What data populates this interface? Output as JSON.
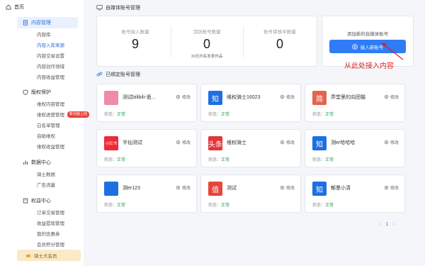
{
  "sidebar": {
    "home": "首页",
    "content_section": "内容管理",
    "content_items": [
      "内容库",
      "内容入库来源",
      "内容交易设置",
      "内容创作领域",
      "内容收益管理"
    ],
    "rights_section": "版权保护",
    "rights_items": [
      "维权内容管理",
      "维权进度管理",
      "白名单管理",
      "自助维权",
      "维权收益管理"
    ],
    "hot_badge": "新功能上线",
    "data_section": "数据中心",
    "data_items": [
      "骑士数据",
      "广告流量"
    ],
    "rights_center_section": "权益中心",
    "rights_center_items": [
      "订单交易管理",
      "收益提现管理",
      "我的优惠券",
      "会员积分管理"
    ],
    "vip_label": "骑士大会员"
  },
  "page": {
    "title": "自媒体账号管理",
    "stats": [
      {
        "label": "账号接入数量",
        "value": "9",
        "note": ""
      },
      {
        "label": "活跃账号数量",
        "value": "0",
        "note": "30天内有发表作品"
      },
      {
        "label": "账号审核中数量",
        "value": "0",
        "note": ""
      }
    ],
    "add_card_label": "添加新的自媒体账号",
    "add_button_label": "接入新账号",
    "annotation": "从此处接入内容",
    "bound_title": "已绑定账号管理",
    "edit_label": "修改",
    "status_prefix": "状态：",
    "status_ok": "正常",
    "pager_current": "1",
    "accounts": [
      {
        "name": "测试bilibili-诡...",
        "logo": "",
        "logo_color": "#f08aa6"
      },
      {
        "name": "维权骑士16023",
        "logo": "知",
        "logo_color": "#1e6fe0"
      },
      {
        "name": "弄堂里的向团猫",
        "logo": "简",
        "logo_color": "#e5634d"
      },
      {
        "name": "半仙测试",
        "logo": "小红书",
        "logo_color": "#ee2a36"
      },
      {
        "name": "维权骑士",
        "logo": "头条",
        "logo_color": "#e4353a"
      },
      {
        "name": "测er哈哈哈",
        "logo": "知",
        "logo_color": "#1e6fe0"
      },
      {
        "name": "测er123",
        "logo": "",
        "logo_color": "#1e6fe0"
      },
      {
        "name": "测试",
        "logo": "值",
        "logo_color": "#e8453c"
      },
      {
        "name": "郁墨小清",
        "logo": "知",
        "logo_color": "#1e6fe0"
      }
    ]
  },
  "colors": {
    "accent": "#2f7cf6",
    "ok": "#2ea44f",
    "annotation": "#e02020"
  }
}
